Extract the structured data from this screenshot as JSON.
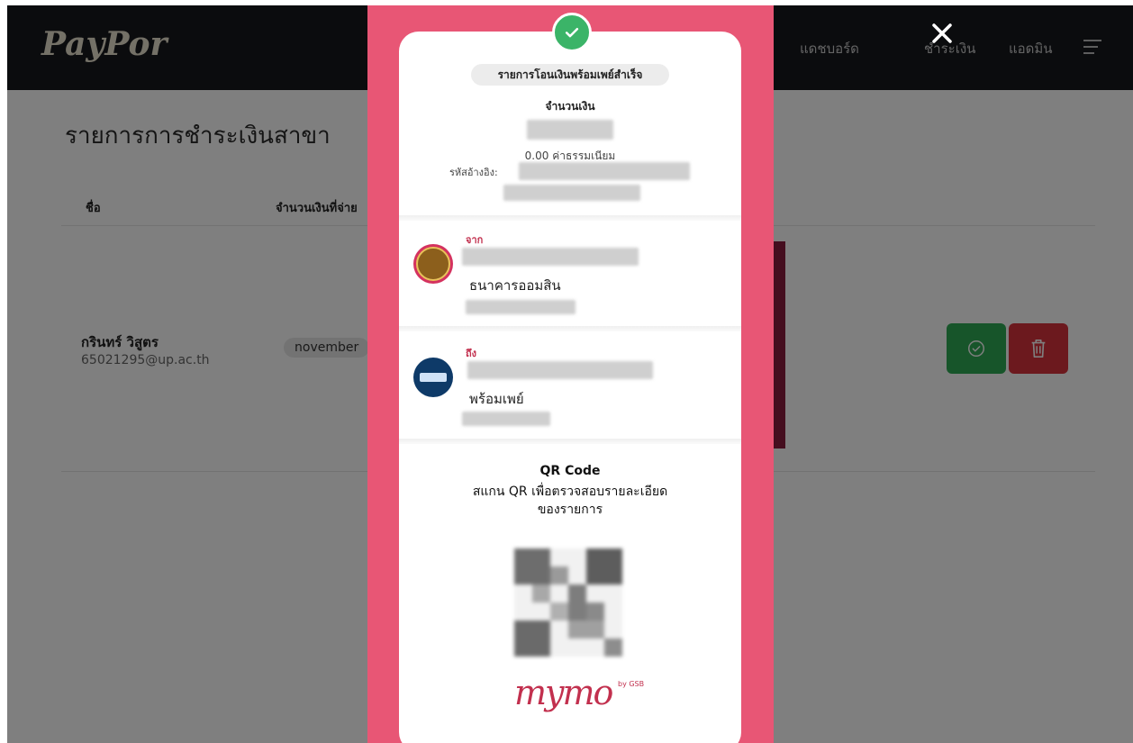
{
  "app": {
    "logo": "PayPor",
    "nav": [
      "แดชบอร์ด",
      "ชำระเงิน",
      "แอดมิน"
    ]
  },
  "page": {
    "title": "รายการการชำระเงินสาขา",
    "columns": [
      "ชื่อ",
      "จำนวนเงินที่จ่าย"
    ]
  },
  "row": {
    "name": "กรินทร์ วิสูตร",
    "email": "65021295@up.ac.th",
    "month": "november"
  },
  "slip": {
    "status": "รายการโอนเงินพร้อมเพย์สำเร็จ",
    "amount_label": "จำนวนเงิน",
    "fee_text": "0.00 ค่าธรรมเนียม",
    "ref_label": "รหัสอ้างอิง:",
    "from_label": "จาก",
    "from_bank": "ธนาคารออมสิน",
    "to_label": "ถึง",
    "to_bank": "พร้อมเพย์",
    "qr_title": "QR Code",
    "qr_desc_1": "สแกน QR เพื่อตรวจสอบรายละเอียด",
    "qr_desc_2": "ของรายการ",
    "brand": "mymo",
    "brand_sub": "by GSB"
  },
  "icons": {
    "close": "close-icon",
    "approve": "check-circle-icon",
    "delete": "trash-icon",
    "menu": "menu-icon",
    "success": "check-icon"
  },
  "colors": {
    "slip_bg": "#e85675",
    "approve": "#2faa54",
    "delete": "#d9323d",
    "brand": "#c2304e"
  }
}
